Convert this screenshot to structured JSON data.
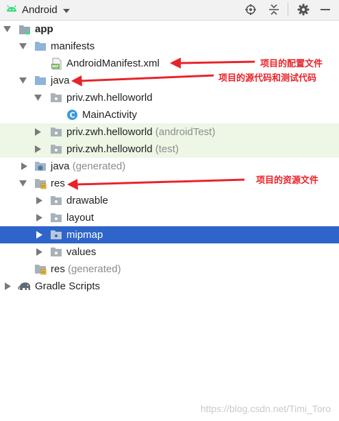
{
  "toolbar": {
    "view_label": "Android",
    "icons": [
      "android-icon",
      "chevron-down-icon",
      "locate-icon",
      "collapse-all-icon",
      "gear-icon",
      "minimize-icon"
    ]
  },
  "tree": {
    "app": "app",
    "manifests": "manifests",
    "android_manifest": "AndroidManifest.xml",
    "java": "java",
    "pkg_main": "priv.zwh.helloworld",
    "main_activity": "MainActivity",
    "pkg_android_test": "priv.zwh.helloworld",
    "pkg_android_test_suffix": "(androidTest)",
    "pkg_test": "priv.zwh.helloworld",
    "pkg_test_suffix": "(test)",
    "java_generated": "java",
    "java_generated_suffix": "(generated)",
    "res": "res",
    "drawable": "drawable",
    "layout": "layout",
    "mipmap": "mipmap",
    "values": "values",
    "res_generated": "res",
    "res_generated_suffix": "(generated)",
    "gradle_scripts": "Gradle Scripts",
    "selected_item": "mipmap"
  },
  "annotations": {
    "config_file": "项目的配置文件",
    "source_and_test": "项目的源代码和测试代码",
    "resources": "项目的资源文件"
  },
  "watermark": "https://blog.csdn.net/Timi_Toro",
  "colors": {
    "selection": "#2f65ca",
    "test_row_bg": "#eef6e6",
    "annotation": "#e8232a",
    "folder": "#8fb3d9",
    "android_green": "#3ddc84"
  }
}
